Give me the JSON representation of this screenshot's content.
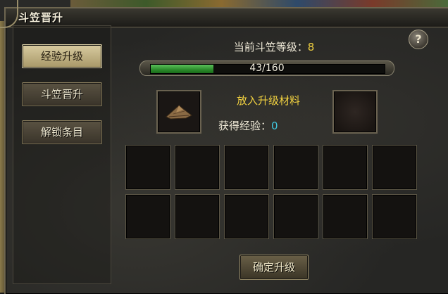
{
  "window": {
    "title": "斗笠晋升"
  },
  "sidebar": {
    "tabs": [
      {
        "label": "经验升级",
        "active": true
      },
      {
        "label": "斗笠晋升",
        "active": false
      },
      {
        "label": "解锁条目",
        "active": false
      }
    ]
  },
  "help": {
    "label": "?"
  },
  "level": {
    "label": "当前斗笠等级：",
    "value": "8"
  },
  "progress": {
    "text": "43/160",
    "current": 43,
    "max": 160
  },
  "material": {
    "source_item": "bamboo-hat-icon",
    "put_label": "放入升级材料",
    "exp_label": "获得经验：",
    "exp_value": "0"
  },
  "grid": {
    "rows": 2,
    "cols": 6
  },
  "confirm": {
    "label": "确定升级"
  },
  "colors": {
    "accent_yellow": "#f0d040",
    "exp_cyan": "#40c8e0",
    "progress_green": "#3aa83a"
  }
}
